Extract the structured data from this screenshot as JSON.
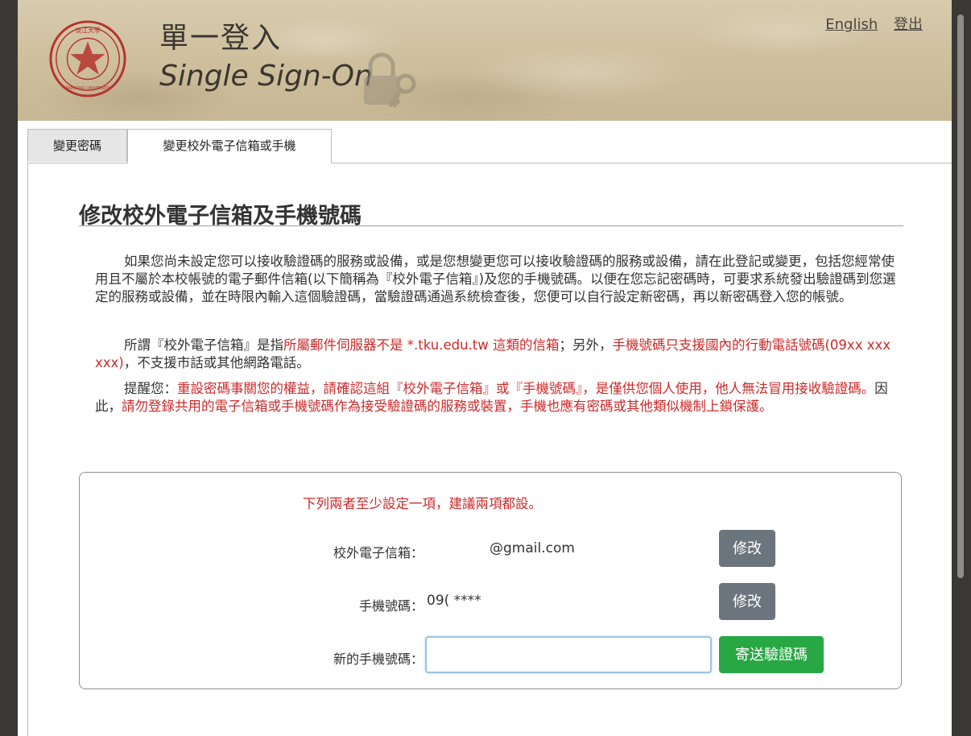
{
  "header": {
    "title_zh": "單一登入",
    "title_en": "Single Sign-On",
    "logo_text_top": "淡江大學",
    "logo_text_bottom": "TAMKANG UNIVERSITY",
    "links": {
      "english": "English",
      "logout": "登出"
    }
  },
  "tabs": [
    {
      "label": "變更密碼",
      "active": false
    },
    {
      "label": "變更校外電子信箱或手機",
      "active": true
    }
  ],
  "main": {
    "heading": "修改校外電子信箱及手機號碼",
    "p1": "如果您尚未設定您可以接收驗證碼的服務或設備，或是您想變更您可以接收驗證碼的服務或設備，請在此登記或變更，包括您經常使用且不屬於本校帳號的電子郵件信箱(以下簡稱為『校外電子信箱』)及您的手機號碼。以便在您忘記密碼時，可要求系統發出驗證碼到您選定的服務或設備，並在時限內輸入這個驗證碼，當驗證碼通過系統檢查後，您便可以自行設定新密碼，再以新密碼登入您的帳號。",
    "p2_a": "所謂『校外電子信箱』是指",
    "p2_b": "所屬郵件伺服器不是 *.tku.edu.tw 這類的信箱",
    "p2_c": "；另外，",
    "p2_d": "手機號碼只支援國內的行動電話號碼(09xx xxx xxx)",
    "p2_e": "，不支援市話或其他網路電話。",
    "p3_a": "提醒您：",
    "p3_b": "重設密碼事關您的權益，請確認這組『校外電子信箱』或『手機號碼』，是僅供您個人使用，他人無法冒用接收驗證碼。",
    "p3_c": "因此，",
    "p3_d": "請勿登錄共用的電子信箱或手機號碼作為接受驗證碼的服務或裝置，手機也應有密碼或其他類似機制上鎖保護。"
  },
  "settings": {
    "notice": "下列兩者至少設定一項，建議兩項都設。",
    "email_label": "校外電子信箱：",
    "email_value": "@gmail.com",
    "phone_label": "手機號碼：",
    "phone_value": "09(       ****",
    "new_phone_label": "新的手機號碼：",
    "new_phone_value": "",
    "edit_label": "修改",
    "send_code_label": "寄送驗證碼"
  },
  "colors": {
    "accent_red": "#cc2a2a",
    "button_grey": "#6c757d",
    "button_green": "#28a745"
  }
}
